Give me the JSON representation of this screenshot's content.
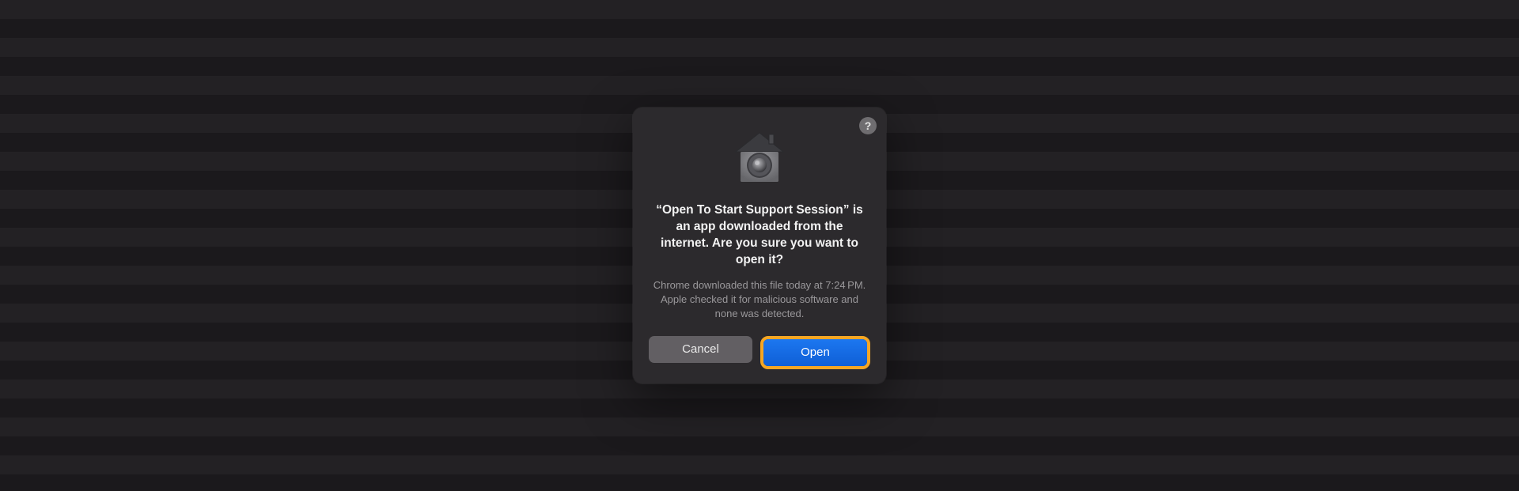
{
  "dialog": {
    "help_label": "?",
    "title": "“Open To Start Support Session” is an app downloaded from the internet. Are you sure you want to open it?",
    "subtitle": "Chrome downloaded this file today at 7:24 PM. Apple checked it for malicious software and none was detected.",
    "cancel_label": "Cancel",
    "open_label": "Open"
  }
}
